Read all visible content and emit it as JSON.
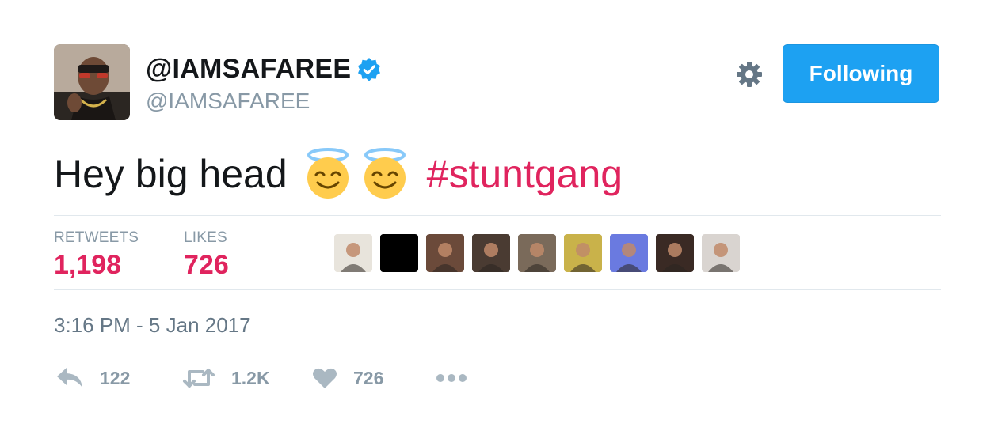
{
  "header": {
    "display_name": "@IAMSAFAREE",
    "handle": "@IAMSAFAREE",
    "verified": true,
    "follow_label": "Following"
  },
  "tweet": {
    "text": "Hey big head",
    "emojis": [
      "smiling-face-with-halo",
      "smiling-face-with-halo"
    ],
    "hashtag": "#stuntgang"
  },
  "stats": {
    "retweets_label": "RETWEETS",
    "retweets_value": "1,198",
    "likes_label": "LIKES",
    "likes_value": "726"
  },
  "likers": [
    {
      "icon": "liker-avatar",
      "color": "#e8e4dc"
    },
    {
      "icon": "liker-avatar",
      "color": "#000000"
    },
    {
      "icon": "liker-avatar",
      "color": "#6b4a3a"
    },
    {
      "icon": "liker-avatar",
      "color": "#4a3b32"
    },
    {
      "icon": "liker-avatar",
      "color": "#7a6a5a"
    },
    {
      "icon": "liker-avatar",
      "color": "#c9b24a"
    },
    {
      "icon": "liker-avatar",
      "color": "#6a7ae0"
    },
    {
      "icon": "liker-avatar",
      "color": "#3a2a24"
    },
    {
      "icon": "liker-avatar",
      "color": "#d9d4d0"
    }
  ],
  "timestamp": "3:16 PM - 5 Jan 2017",
  "actions": {
    "reply_count": "122",
    "retweet_count": "1.2K",
    "like_count": "726"
  },
  "colors": {
    "accent": "#1da1f2",
    "like_red": "#e0245e",
    "muted": "#8899a6",
    "text": "#14171a"
  }
}
